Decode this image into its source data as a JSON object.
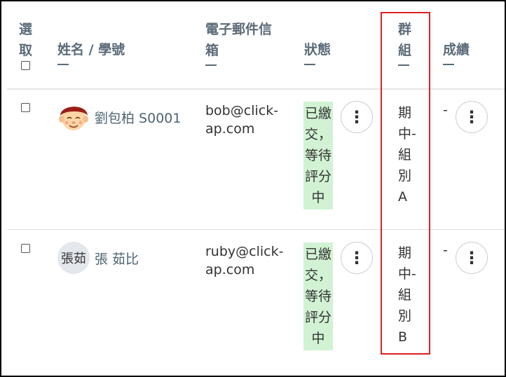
{
  "header": {
    "select": [
      "選",
      "取"
    ],
    "name": "姓名 / 學號",
    "email": [
      "電子郵件信",
      "箱"
    ],
    "status": "狀態",
    "group": [
      "群",
      "組"
    ],
    "grade": "成績"
  },
  "rows": [
    {
      "name": "劉包柏 S0001",
      "avatar": "cartoon-avatar",
      "email": [
        "bob@click-",
        "ap.com"
      ],
      "status": [
        "已繳",
        "交，",
        "等待",
        "評分",
        "中"
      ],
      "group": [
        "期",
        "中-",
        "組",
        "別",
        "A"
      ],
      "grade": "-"
    },
    {
      "name": "張 茹比",
      "avatar_text": "張茹",
      "email": [
        "ruby@click-",
        "ap.com"
      ],
      "status": [
        "已繳",
        "交，",
        "等待",
        "評分",
        "中"
      ],
      "group": [
        "期",
        "中-",
        "組",
        "別",
        "B"
      ],
      "grade": "-"
    }
  ],
  "icons": {
    "more": "⋮"
  },
  "colors": {
    "status_bg": "#d1f3d3",
    "highlight": "#e02020",
    "header": "#5b6b78"
  }
}
